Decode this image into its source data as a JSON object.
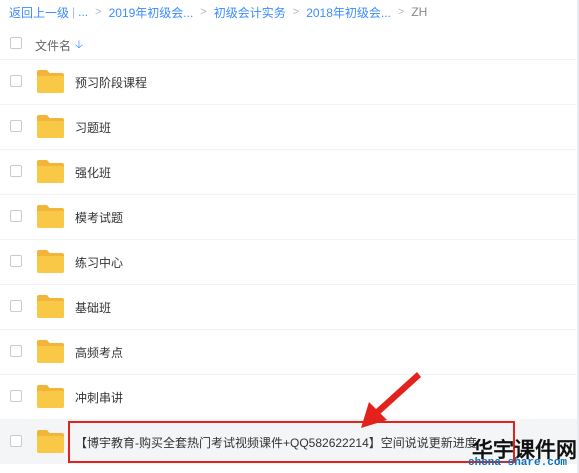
{
  "breadcrumb": {
    "back": "返回上一级",
    "pipe": "|",
    "ellipsis": "...",
    "items": [
      "2019年初级会...",
      "初级会计实务",
      "2018年初级会...",
      "ZH"
    ]
  },
  "header": {
    "column_name": "文件名",
    "sort_icon": "arrow-down-icon"
  },
  "files": [
    {
      "name": "预习阶段课程",
      "type": "folder"
    },
    {
      "name": "习题班",
      "type": "folder"
    },
    {
      "name": "强化班",
      "type": "folder"
    },
    {
      "name": "模考试题",
      "type": "folder"
    },
    {
      "name": "练习中心",
      "type": "folder"
    },
    {
      "name": "基础班",
      "type": "folder"
    },
    {
      "name": "高频考点",
      "type": "folder"
    },
    {
      "name": "冲刺串讲",
      "type": "folder"
    },
    {
      "name": "【博宇教育-购买全套热门考试视频课件+QQ582622214】空间说说更新进度",
      "type": "folder"
    }
  ],
  "watermark": {
    "main": "华宇课件网",
    "sub": "chona-share.com"
  },
  "colors": {
    "link": "#3b8cff",
    "folder": "#f9c846",
    "annotation": "#e3221b"
  }
}
